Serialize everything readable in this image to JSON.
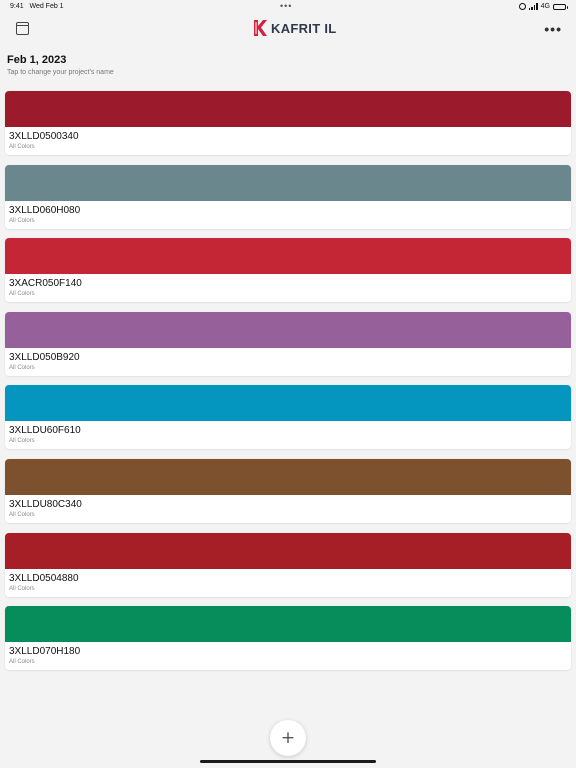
{
  "status_bar": {
    "time": "9:41",
    "date": "Wed Feb 1",
    "dots": "•••",
    "network": "4G"
  },
  "nav": {
    "brand": "KAFRIT IL",
    "brand_color": "#d4213d",
    "more": "•••"
  },
  "header": {
    "title": "Feb 1, 2023",
    "hint": "Tap to change your project's name"
  },
  "cards": [
    {
      "code": "3XLLD0500340",
      "subtitle": "All Colors",
      "color": "#9b1a2b"
    },
    {
      "code": "3XLLD060H080",
      "subtitle": "All Colors",
      "color": "#6b878e"
    },
    {
      "code": "3XACR050F140",
      "subtitle": "All Colors",
      "color": "#c42636"
    },
    {
      "code": "3XLLD050B920",
      "subtitle": "All Colors",
      "color": "#96619b"
    },
    {
      "code": "3XLLDU60F610",
      "subtitle": "All Colors",
      "color": "#0596bf"
    },
    {
      "code": "3XLLDU80C340",
      "subtitle": "All Colors",
      "color": "#7e512e"
    },
    {
      "code": "3XLLD0504880",
      "subtitle": "All Colors",
      "color": "#a61f27"
    },
    {
      "code": "3XLLD070H180",
      "subtitle": "All Colors",
      "color": "#078c5c"
    }
  ],
  "fab": {
    "label": "+"
  }
}
